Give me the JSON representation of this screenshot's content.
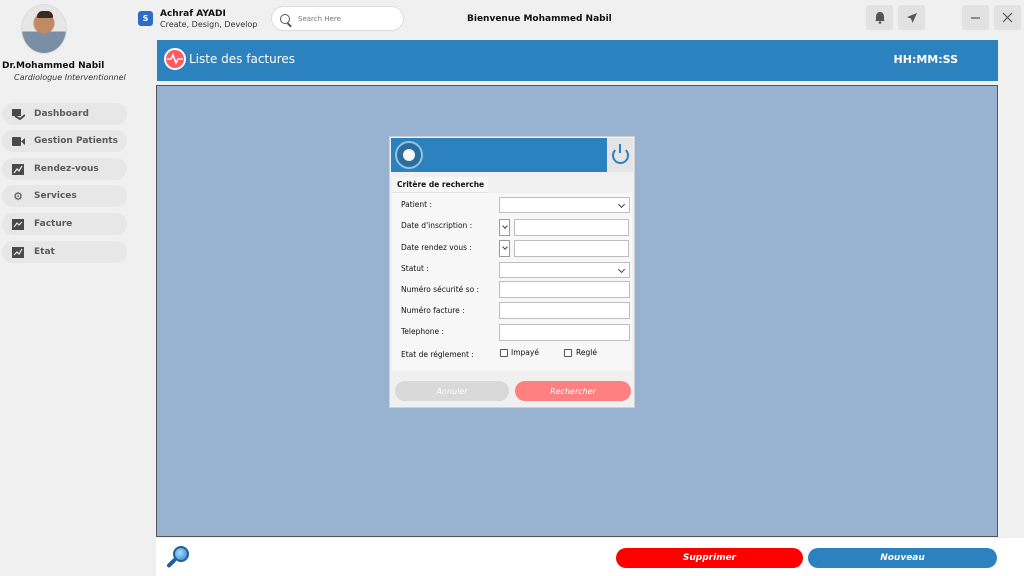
{
  "sidebar": {
    "doctor_name": "Dr.Mohammed Nabil",
    "doctor_role": "Cardiologue Interventionnel",
    "items": [
      {
        "label": "Dashboard",
        "icon": "dashboard-icon"
      },
      {
        "label": "Gestion Patients",
        "icon": "video-camera-icon"
      },
      {
        "label": "Rendez-vous",
        "icon": "chart-icon"
      },
      {
        "label": "Services",
        "icon": "gear-icon"
      },
      {
        "label": "Facture",
        "icon": "invoice-icon"
      },
      {
        "label": "Etat",
        "icon": "report-icon"
      }
    ]
  },
  "topbar": {
    "brand_name": "Achraf AYADI",
    "brand_tagline": "Create, Design, Develop",
    "brand_icon_text": "S",
    "search_placeholder": "Search Here",
    "welcome": "Bienvenue Mohammed Nabil"
  },
  "header": {
    "title": "Liste des factures",
    "clock": "HH:MM:SS"
  },
  "dialog": {
    "tab_label": "Critère de recherche",
    "fields": {
      "patient": "Patient :",
      "date_inscription": "Date d'inscription :",
      "date_rdv": "Date rendez vous :",
      "statut": "Statut  :",
      "num_secu": "Numéro sécurité so :",
      "num_facture": "Numéro facture :",
      "telephone": "Telephone   :",
      "etat_reglement": "Etat de réglement  :"
    },
    "checkboxes": {
      "impaye": "Impayé",
      "regle": "Reglé"
    },
    "buttons": {
      "annuler": "Annuler",
      "rechercher": "Rechercher"
    }
  },
  "footer": {
    "supprimer": "Supprimer",
    "nouveau": "Nouveau"
  },
  "colors": {
    "primary": "#2c82be",
    "panel": "#97b3d1",
    "danger": "#ff0000",
    "accent_soft": "#ff8080"
  }
}
